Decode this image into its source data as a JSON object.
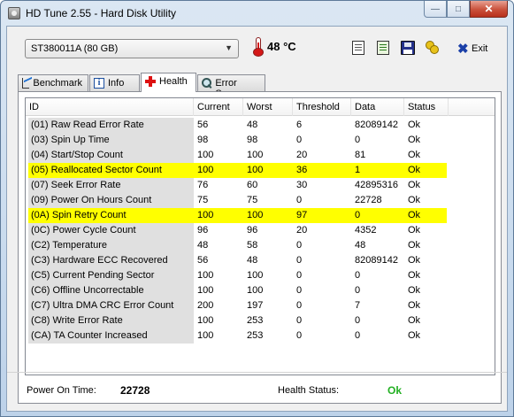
{
  "window": {
    "title": "HD Tune 2.55 - Hard Disk Utility"
  },
  "toolbar": {
    "drive": "ST380011A (80 GB)",
    "temperature": "48 °C",
    "exit_label": "Exit"
  },
  "tabs": [
    {
      "label": "Benchmark",
      "icon": "benchmark-icon",
      "active": false
    },
    {
      "label": "Info",
      "icon": "info-icon",
      "active": false
    },
    {
      "label": "Health",
      "icon": "health-icon",
      "active": true
    },
    {
      "label": "Error Scan",
      "icon": "error-scan-icon",
      "active": false
    }
  ],
  "table": {
    "columns": [
      "ID",
      "Current",
      "Worst",
      "Threshold",
      "Data",
      "Status"
    ],
    "highlight_color": "#ffff00",
    "rows": [
      {
        "id": "(01) Raw Read Error Rate",
        "current": "56",
        "worst": "48",
        "threshold": "6",
        "data": "82089142",
        "status": "Ok",
        "highlighted": false
      },
      {
        "id": "(03) Spin Up Time",
        "current": "98",
        "worst": "98",
        "threshold": "0",
        "data": "0",
        "status": "Ok",
        "highlighted": false
      },
      {
        "id": "(04) Start/Stop Count",
        "current": "100",
        "worst": "100",
        "threshold": "20",
        "data": "81",
        "status": "Ok",
        "highlighted": false
      },
      {
        "id": "(05) Reallocated Sector Count",
        "current": "100",
        "worst": "100",
        "threshold": "36",
        "data": "1",
        "status": "Ok",
        "highlighted": true
      },
      {
        "id": "(07) Seek Error Rate",
        "current": "76",
        "worst": "60",
        "threshold": "30",
        "data": "42895316",
        "status": "Ok",
        "highlighted": false
      },
      {
        "id": "(09) Power On Hours Count",
        "current": "75",
        "worst": "75",
        "threshold": "0",
        "data": "22728",
        "status": "Ok",
        "highlighted": false
      },
      {
        "id": "(0A) Spin Retry Count",
        "current": "100",
        "worst": "100",
        "threshold": "97",
        "data": "0",
        "status": "Ok",
        "highlighted": true
      },
      {
        "id": "(0C) Power Cycle Count",
        "current": "96",
        "worst": "96",
        "threshold": "20",
        "data": "4352",
        "status": "Ok",
        "highlighted": false
      },
      {
        "id": "(C2) Temperature",
        "current": "48",
        "worst": "58",
        "threshold": "0",
        "data": "48",
        "status": "Ok",
        "highlighted": false
      },
      {
        "id": "(C3) Hardware ECC Recovered",
        "current": "56",
        "worst": "48",
        "threshold": "0",
        "data": "82089142",
        "status": "Ok",
        "highlighted": false
      },
      {
        "id": "(C5) Current Pending Sector",
        "current": "100",
        "worst": "100",
        "threshold": "0",
        "data": "0",
        "status": "Ok",
        "highlighted": false
      },
      {
        "id": "(C6) Offline Uncorrectable",
        "current": "100",
        "worst": "100",
        "threshold": "0",
        "data": "0",
        "status": "Ok",
        "highlighted": false
      },
      {
        "id": "(C7) Ultra DMA CRC Error Count",
        "current": "200",
        "worst": "197",
        "threshold": "0",
        "data": "7",
        "status": "Ok",
        "highlighted": false
      },
      {
        "id": "(C8) Write Error Rate",
        "current": "100",
        "worst": "253",
        "threshold": "0",
        "data": "0",
        "status": "Ok",
        "highlighted": false
      },
      {
        "id": "(CA) TA Counter Increased",
        "current": "100",
        "worst": "253",
        "threshold": "0",
        "data": "0",
        "status": "Ok",
        "highlighted": false
      }
    ]
  },
  "status_bar": {
    "power_on_label": "Power On Time:",
    "power_on_value": "22728",
    "health_label": "Health Status:",
    "health_value": "Ok",
    "health_color": "#22b022"
  }
}
